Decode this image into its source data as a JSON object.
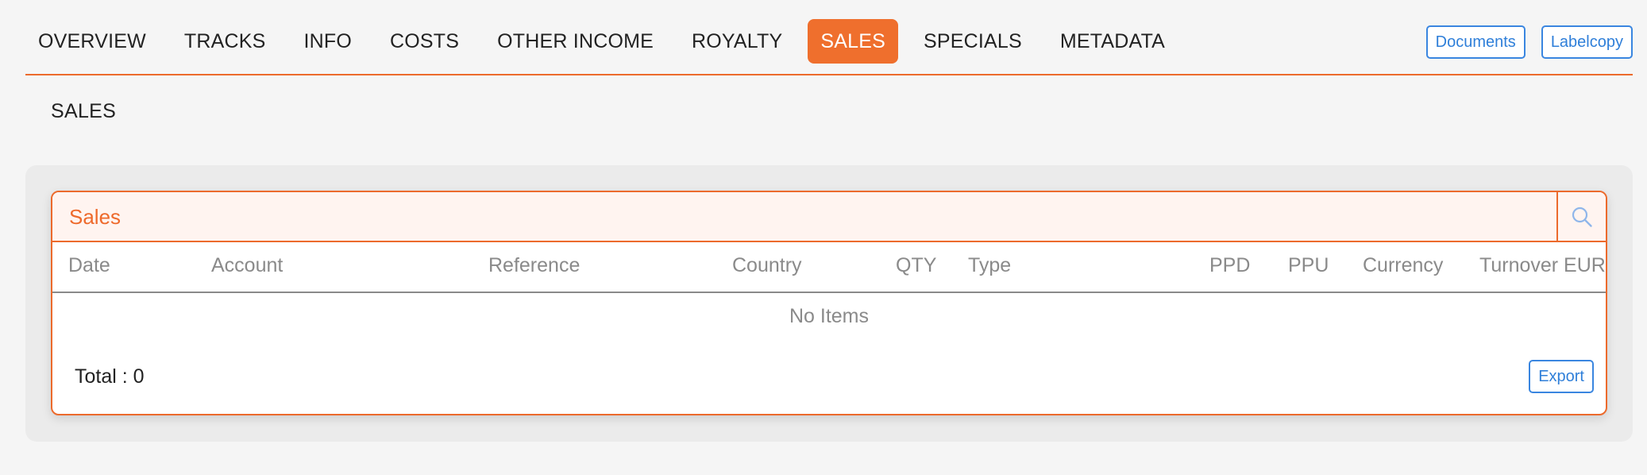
{
  "nav": {
    "tabs": [
      {
        "label": "OVERVIEW"
      },
      {
        "label": "TRACKS"
      },
      {
        "label": "INFO"
      },
      {
        "label": "COSTS"
      },
      {
        "label": "OTHER INCOME"
      },
      {
        "label": "ROYALTY"
      },
      {
        "label": "SALES",
        "active": true
      },
      {
        "label": "SPECIALS"
      },
      {
        "label": "METADATA"
      }
    ],
    "documents_label": "Documents",
    "labelcopy_label": "Labelcopy"
  },
  "page": {
    "heading": "SALES"
  },
  "sales_table": {
    "title": "Sales",
    "search_icon": "search-icon",
    "columns": [
      "Date",
      "Account",
      "Reference",
      "Country",
      "QTY",
      "Type",
      "PPD",
      "PPU",
      "Currency",
      "Turnover EUR"
    ],
    "empty_text": "No Items",
    "total_label": "Total : 0",
    "export_label": "Export"
  },
  "colors": {
    "accent": "#ef6f2d",
    "link_blue": "#2f7fd9",
    "muted_text": "#8a8a8a",
    "header_tint": "#fff4f0"
  }
}
